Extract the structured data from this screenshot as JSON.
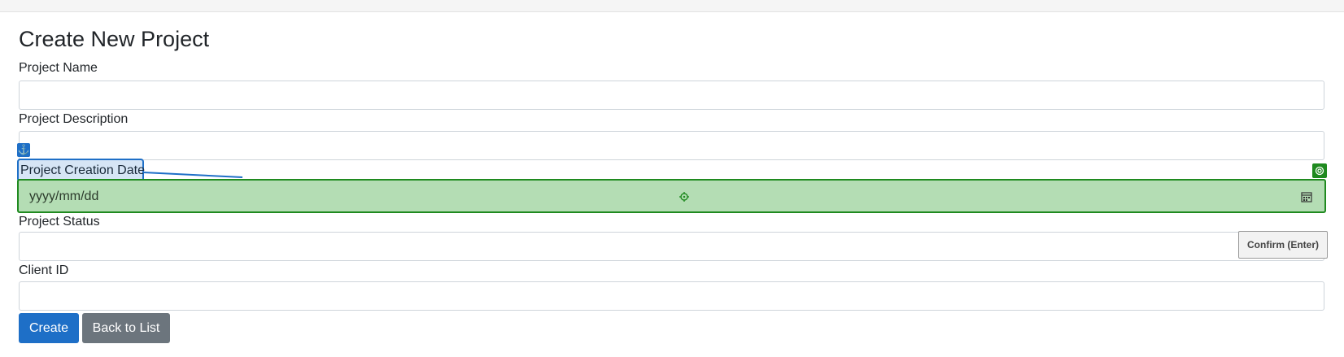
{
  "page": {
    "title": "Create New Project"
  },
  "form": {
    "fields": [
      {
        "label": "Project Name",
        "value": ""
      },
      {
        "label": "Project Description",
        "value": ""
      },
      {
        "label": "Project Creation Date",
        "placeholder": "yyyy/mm/dd"
      },
      {
        "label": "Project Status",
        "value": ""
      },
      {
        "label": "Client ID",
        "value": ""
      }
    ]
  },
  "overlay": {
    "anchor_glyph": "⚓",
    "confirm_label": "Confirm (Enter)"
  },
  "actions": {
    "create_label": "Create",
    "back_label": "Back to List"
  },
  "colors": {
    "primary": "#1e6fc7",
    "secondary": "#6c757d",
    "highlight_fill": "#b4ddb4",
    "highlight_border": "#1f8a1f"
  }
}
